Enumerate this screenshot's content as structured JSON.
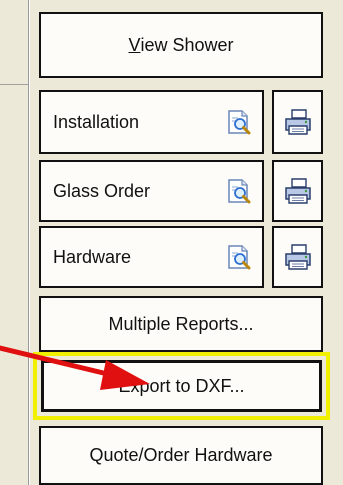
{
  "buttons": {
    "view_shower": {
      "prefix_underlined": "V",
      "rest": "iew Shower"
    },
    "installation": "Installation",
    "glass_order": "Glass Order",
    "hardware": "Hardware",
    "multiple_reports": "Multiple Reports...",
    "export_dxf": "Export to DXF...",
    "quote_order_hardware": "Quote/Order Hardware"
  },
  "icons": {
    "preview": "preview-magnifier-icon",
    "print": "printer-icon"
  },
  "colors": {
    "highlight": "#f0f000",
    "arrow": "#e01010",
    "panel_bg": "#ece9d8",
    "button_bg": "#fdfcf8"
  }
}
